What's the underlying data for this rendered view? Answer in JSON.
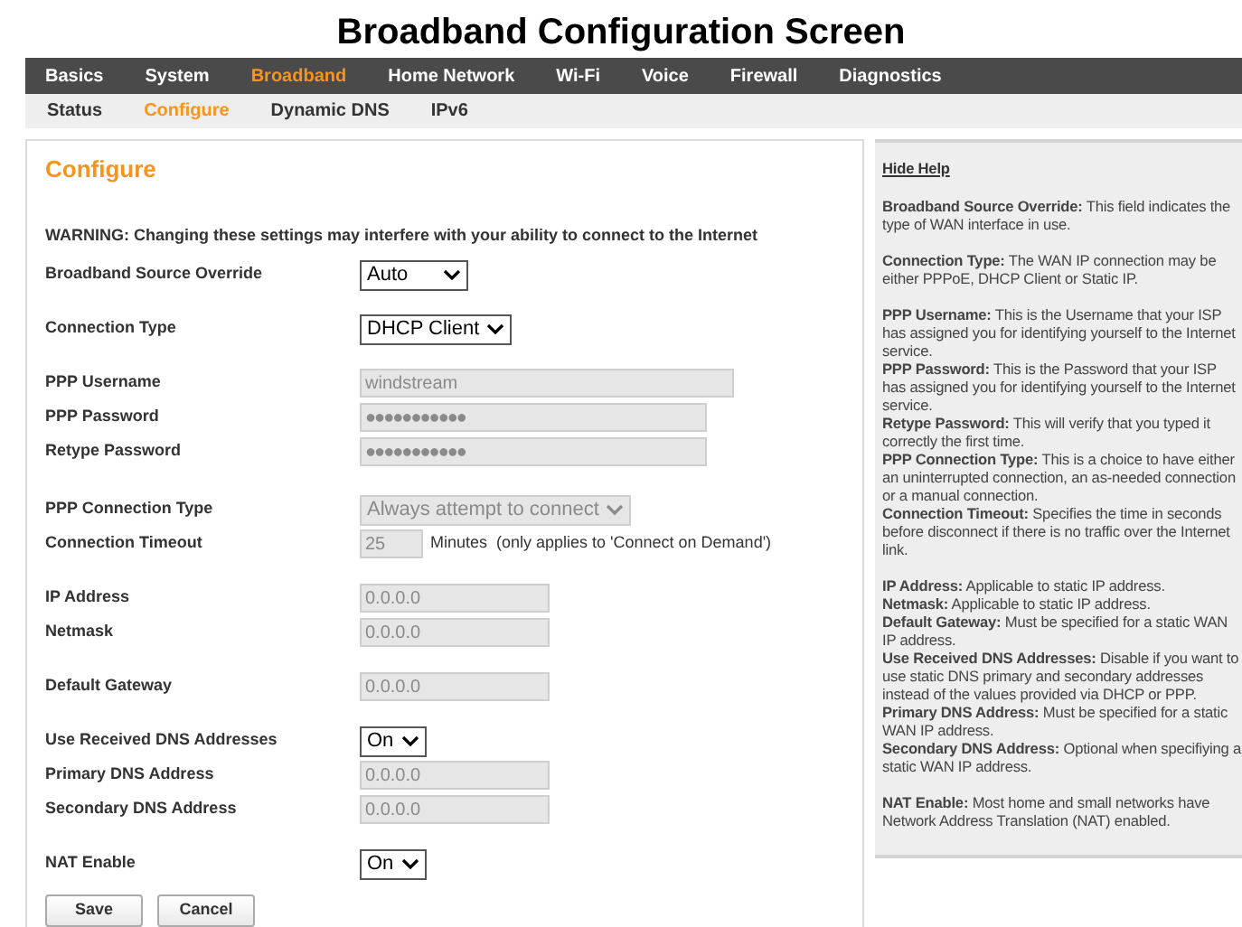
{
  "page_title": "Broadband Configuration Screen",
  "nav": [
    {
      "label": "Basics",
      "selected": false
    },
    {
      "label": "System",
      "selected": false
    },
    {
      "label": "Broadband",
      "selected": true
    },
    {
      "label": "Home Network",
      "selected": false
    },
    {
      "label": "Wi-Fi",
      "selected": false
    },
    {
      "label": "Voice",
      "selected": false
    },
    {
      "label": "Firewall",
      "selected": false
    },
    {
      "label": "Diagnostics",
      "selected": false
    }
  ],
  "subnav": [
    {
      "label": "Status",
      "selected": false
    },
    {
      "label": "Configure",
      "selected": true
    },
    {
      "label": "Dynamic DNS",
      "selected": false
    },
    {
      "label": "IPv6",
      "selected": false
    }
  ],
  "panel_title": "Configure",
  "warning": "WARNING: Changing these settings may interfere with your ability to connect to the Internet",
  "form_groups": [
    [
      {
        "kind": "select",
        "label": "Broadband Source Override",
        "value": "Auto",
        "disabled": false
      }
    ],
    [
      {
        "kind": "select",
        "label": "Connection Type",
        "value": "DHCP Client",
        "disabled": false
      }
    ],
    [
      {
        "kind": "username",
        "label": "PPP Username",
        "value": "windstream",
        "disabled": true
      },
      {
        "kind": "password",
        "label": "PPP Password",
        "value": "●●●●●●●●●●●",
        "disabled": true
      },
      {
        "kind": "password",
        "label": "Retype Password",
        "value": "●●●●●●●●●●●",
        "disabled": true
      },
      {
        "kind": "spacer"
      },
      {
        "kind": "select",
        "label": "PPP Connection Type",
        "value": "Always attempt to connect",
        "disabled": true
      },
      {
        "kind": "timeout",
        "label": "Connection Timeout",
        "value": "25",
        "note": "Minutes  (only applies to 'Connect on Demand')",
        "disabled": true
      }
    ],
    [
      {
        "kind": "address",
        "label": "IP Address",
        "value": "0.0.0.0",
        "disabled": true
      },
      {
        "kind": "address",
        "label": "Netmask",
        "value": "0.0.0.0",
        "disabled": true
      }
    ],
    [
      {
        "kind": "address",
        "label": "Default Gateway",
        "value": "0.0.0.0",
        "disabled": true
      }
    ],
    [
      {
        "kind": "select",
        "label": "Use Received DNS Addresses",
        "value": "On",
        "disabled": false
      },
      {
        "kind": "address",
        "label": "Primary DNS Address",
        "value": "0.0.0.0",
        "disabled": true
      },
      {
        "kind": "address",
        "label": "Secondary DNS Address",
        "value": "0.0.0.0",
        "disabled": true
      }
    ],
    [
      {
        "kind": "select",
        "label": "NAT Enable",
        "value": "On",
        "disabled": false
      }
    ]
  ],
  "buttons": [
    "Save",
    "Cancel"
  ],
  "help": {
    "toggle": "Hide Help",
    "groups": [
      [
        "**Broadband Source Override:** This field indicates the type of WAN interface in use."
      ],
      [
        "**Connection Type:** The WAN IP connection may be either PPPoE, DHCP Client or Static IP."
      ],
      [
        "**PPP Username:** This is the Username that your ISP has assigned you for identifying yourself to the Internet service.",
        "**PPP Password:** This is the Password that your ISP has assigned you for identifying yourself to the Internet service.",
        "**Retype Password:** This will verify that you typed it correctly the first time.",
        "**PPP Connection Type:** This is a choice to have either an uninterrupted connection, an as-needed connection or a manual connection.",
        "**Connection Timeout:** Specifies the time in seconds before disconnect if there is no traffic over the Internet link."
      ],
      [
        "**IP Address:** Applicable to static IP address.",
        "**Netmask:** Applicable to static IP address.",
        "**Default Gateway:** Must be specified for a static WAN IP address.",
        "**Use Received DNS Addresses:** Disable if you want to use static DNS primary and secondary addresses instead of the values provided via DHCP or PPP.",
        "**Primary DNS Address:** Must be specified for a static WAN IP address.",
        "**Secondary DNS Address:** Optional when specifiying a static WAN IP address."
      ],
      [
        "**NAT Enable:** Most home and small networks have Network Address Translation (NAT) enabled."
      ]
    ]
  }
}
